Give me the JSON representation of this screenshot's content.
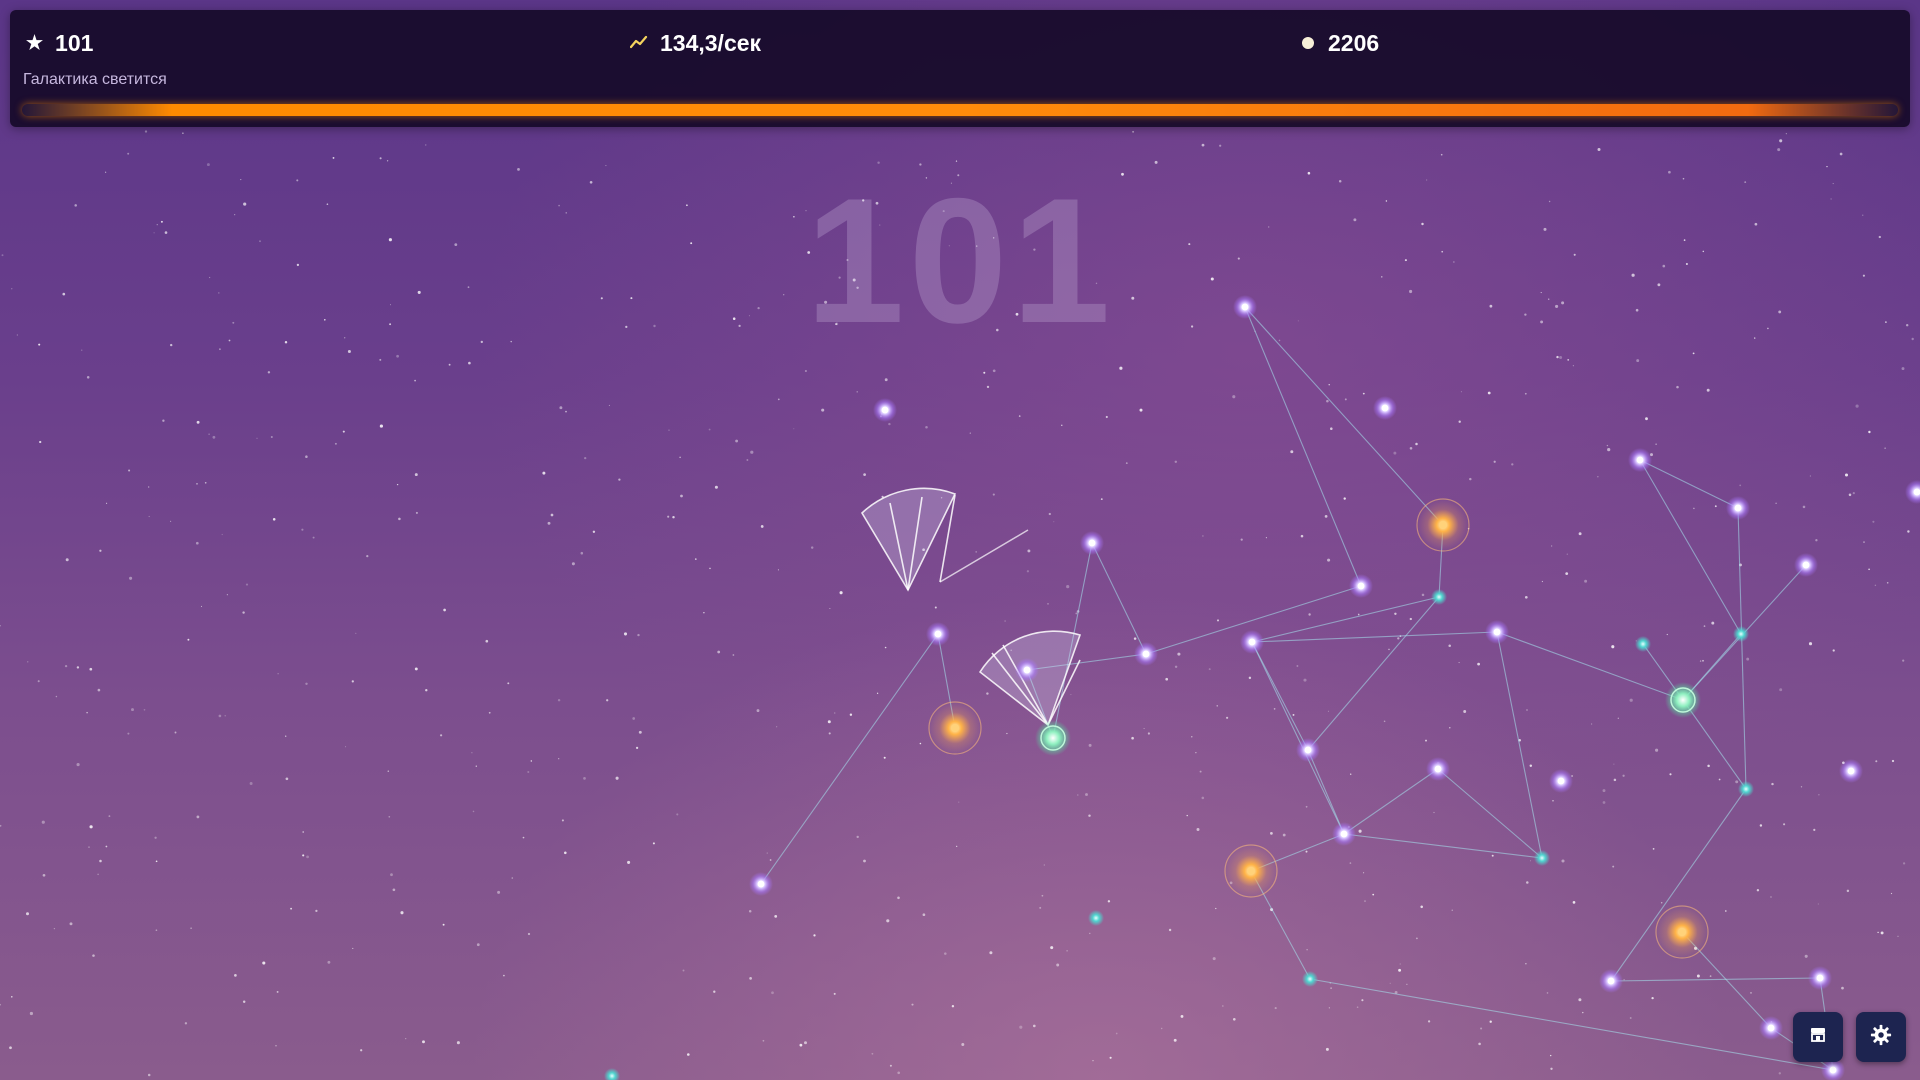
{
  "hud": {
    "stars_icon": "star-icon",
    "stars": "101",
    "rate_icon": "trend-up-icon",
    "rate": "134,3/сек",
    "coins_icon": "coin-icon",
    "coins": "2206",
    "subtitle": "Галактика светится",
    "progress_fraction": 1.0,
    "progress_color": "#ff8a00"
  },
  "center_counter": "101",
  "buttons": {
    "shop_icon": "shop-icon",
    "settings_icon": "gear-icon"
  },
  "colors": {
    "star": "#c8a8ff",
    "green_star": "#5fe0a0",
    "orange_star": "#ffb347",
    "teal_star": "#4fd6d0",
    "line": "#9fd8e8"
  }
}
